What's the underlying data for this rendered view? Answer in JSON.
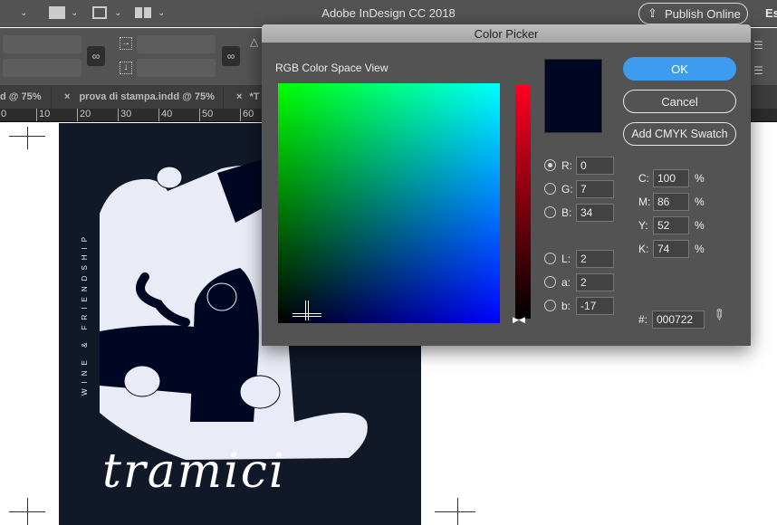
{
  "app": {
    "title": "Adobe InDesign CC 2018",
    "publish_label": "Publish Online",
    "workspace_label": "Es"
  },
  "tabs": [
    {
      "label": "d @ 75%"
    },
    {
      "label": "prova di stampa.indd @ 75%"
    },
    {
      "label": "*T"
    }
  ],
  "ruler": [
    "0",
    "10",
    "20",
    "30",
    "40",
    "50",
    "60"
  ],
  "document": {
    "vertical_text": "WINE & FRIENDSHIP",
    "wordmark": "tramici",
    "background": "#111827"
  },
  "dialog": {
    "title": "Color Picker",
    "view_label": "RGB Color Space View",
    "ok": "OK",
    "cancel": "Cancel",
    "add_swatch": "Add CMYK Swatch",
    "current_color": "#000722",
    "rgb": [
      {
        "label": "R:",
        "value": "0",
        "selected": true
      },
      {
        "label": "G:",
        "value": "7"
      },
      {
        "label": "B:",
        "value": "34"
      }
    ],
    "lab": [
      {
        "label": "L:",
        "value": "2"
      },
      {
        "label": "a:",
        "value": "2"
      },
      {
        "label": "b:",
        "value": "-17"
      }
    ],
    "cmyk": [
      {
        "label": "C:",
        "value": "100",
        "unit": "%"
      },
      {
        "label": "M:",
        "value": "86",
        "unit": "%"
      },
      {
        "label": "Y:",
        "value": "52",
        "unit": "%"
      },
      {
        "label": "K:",
        "value": "74",
        "unit": "%"
      }
    ],
    "hex_label": "#:",
    "hex_value": "000722"
  }
}
